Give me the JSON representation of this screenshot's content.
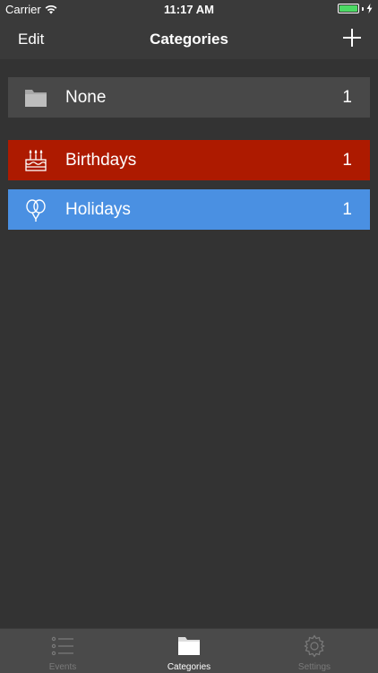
{
  "status_bar": {
    "carrier": "Carrier",
    "time": "11:17 AM",
    "battery_color": "#4cd964"
  },
  "nav": {
    "edit_label": "Edit",
    "title": "Categories",
    "add_icon": "plus-icon"
  },
  "categories": [
    {
      "label": "None",
      "count": "1",
      "icon": "folder-icon",
      "color": "#484848"
    },
    {
      "label": "Birthdays",
      "count": "1",
      "icon": "birthday-cake-icon",
      "color": "#ad1a00"
    },
    {
      "label": "Holidays",
      "count": "1",
      "icon": "balloons-icon",
      "color": "#4a90e2"
    }
  ],
  "tab_bar": {
    "tabs": [
      {
        "label": "Events",
        "icon": "list-icon",
        "active": false
      },
      {
        "label": "Categories",
        "icon": "folder-icon",
        "active": true
      },
      {
        "label": "Settings",
        "icon": "gear-icon",
        "active": false
      }
    ]
  }
}
